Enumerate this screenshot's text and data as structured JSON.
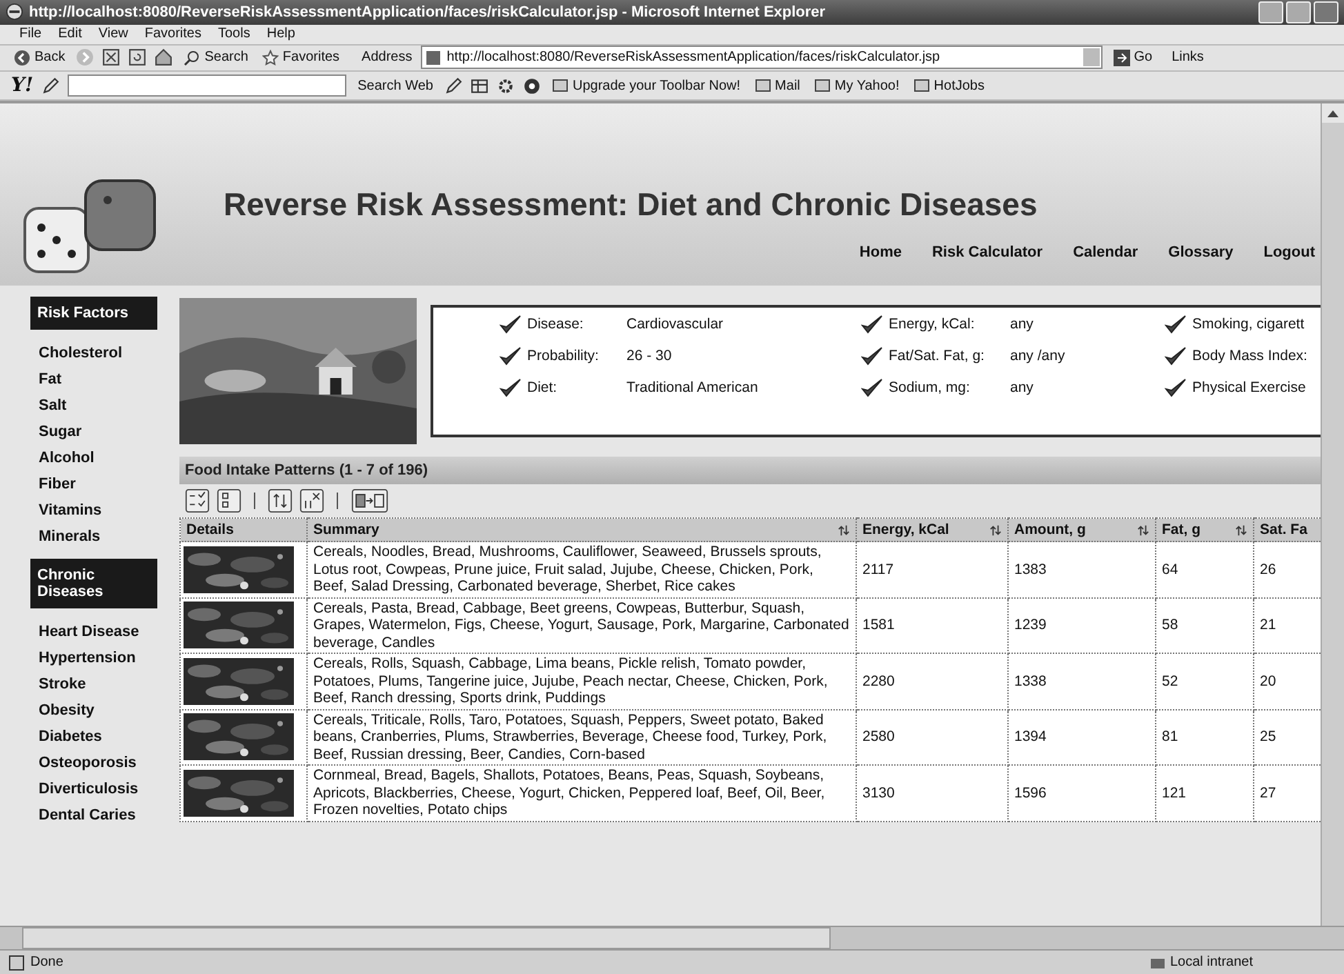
{
  "window": {
    "title": "http://localhost:8080/ReverseRiskAssessmentApplication/faces/riskCalculator.jsp - Microsoft Internet Explorer"
  },
  "menu": [
    "File",
    "Edit",
    "View",
    "Favorites",
    "Tools",
    "Help"
  ],
  "toolbar": {
    "back": "Back",
    "search": "Search",
    "favorites": "Favorites",
    "address_label": "Address",
    "address": "http://localhost:8080/ReverseRiskAssessmentApplication/faces/riskCalculator.jsp",
    "go": "Go",
    "links": "Links"
  },
  "yahoo_toolbar": {
    "logo": "Y!",
    "search_web": "Search Web",
    "items": [
      "Upgrade your Toolbar Now!",
      "Mail",
      "My Yahoo!",
      "HotJobs"
    ]
  },
  "page": {
    "title": "Reverse Risk Assessment: Diet and Chronic Diseases",
    "nav": [
      "Home",
      "Risk Calculator",
      "Calendar",
      "Glossary",
      "Logout"
    ]
  },
  "sidebar": [
    {
      "heading": "Risk Factors",
      "items": [
        "Cholesterol",
        "Fat",
        "Salt",
        "Sugar",
        "Alcohol",
        "Fiber",
        "Vitamins",
        "Minerals"
      ]
    },
    {
      "heading": "Chronic Diseases",
      "items": [
        "Heart Disease",
        "Hypertension",
        "Stroke",
        "Obesity",
        "Diabetes",
        "Osteoporosis",
        "Diverticulosis",
        "Dental Caries"
      ]
    }
  ],
  "filters": [
    {
      "items": [
        {
          "label": "Disease:",
          "value": "Cardiovascular"
        },
        {
          "label": "Probability:",
          "value": "26 - 30"
        },
        {
          "label": "Diet:",
          "value": "Traditional American"
        }
      ]
    },
    {
      "items": [
        {
          "label": "Energy, kCal:",
          "value": "any"
        },
        {
          "label": "Fat/Sat. Fat, g:",
          "value": "any /any"
        },
        {
          "label": "Sodium, mg:",
          "value": "any"
        }
      ]
    },
    {
      "items": [
        {
          "label": "Smoking, cigarett"
        },
        {
          "label": "Body Mass Index:"
        },
        {
          "label": "Physical Exercise"
        }
      ]
    }
  ],
  "table": {
    "title": "Food Intake Patterns (1 - 7 of 196)",
    "columns": [
      {
        "label": "Details",
        "sortable": false
      },
      {
        "label": "Summary",
        "sortable": true
      },
      {
        "label": "Energy, kCal",
        "sortable": true
      },
      {
        "label": "Amount, g",
        "sortable": true
      },
      {
        "label": "Fat, g",
        "sortable": true
      },
      {
        "label": "Sat. Fa"
      }
    ],
    "rows": [
      {
        "summary": "Cereals, Noodles, Bread, Mushrooms, Cauliflower, Seaweed, Brussels sprouts, Lotus root, Cowpeas, Prune juice, Fruit salad, Jujube, Cheese, Chicken, Pork, Beef, Salad Dressing, Carbonated beverage, Sherbet, Rice cakes",
        "energy": "2117",
        "amount": "1383",
        "fat": "64",
        "sat_fat": "26"
      },
      {
        "summary": "Cereals, Pasta, Bread, Cabbage, Beet greens, Cowpeas, Butterbur, Squash, Grapes, Watermelon, Figs, Cheese, Yogurt, Sausage, Pork, Margarine, Carbonated beverage, Candles",
        "energy": "1581",
        "amount": "1239",
        "fat": "58",
        "sat_fat": "21"
      },
      {
        "summary": "Cereals, Rolls, Squash, Cabbage, Lima beans, Pickle relish, Tomato powder, Potatoes, Plums, Tangerine juice, Jujube, Peach nectar, Cheese, Chicken, Pork, Beef, Ranch dressing, Sports drink, Puddings",
        "energy": "2280",
        "amount": "1338",
        "fat": "52",
        "sat_fat": "20"
      },
      {
        "summary": "Cereals, Triticale, Rolls, Taro, Potatoes, Squash, Peppers, Sweet potato, Baked beans, Cranberries, Plums, Strawberries, Beverage, Cheese food, Turkey, Pork, Beef, Russian dressing, Beer, Candies, Corn-based",
        "energy": "2580",
        "amount": "1394",
        "fat": "81",
        "sat_fat": "25"
      },
      {
        "summary": "Cornmeal, Bread, Bagels, Shallots, Potatoes, Beans, Peas, Squash, Soybeans, Apricots, Blackberries, Cheese, Yogurt, Chicken, Peppered loaf, Beef, Oil, Beer, Frozen novelties, Potato chips",
        "energy": "3130",
        "amount": "1596",
        "fat": "121",
        "sat_fat": "27"
      }
    ]
  },
  "status_bar": {
    "text": "Done",
    "zone": "Local intranet"
  }
}
